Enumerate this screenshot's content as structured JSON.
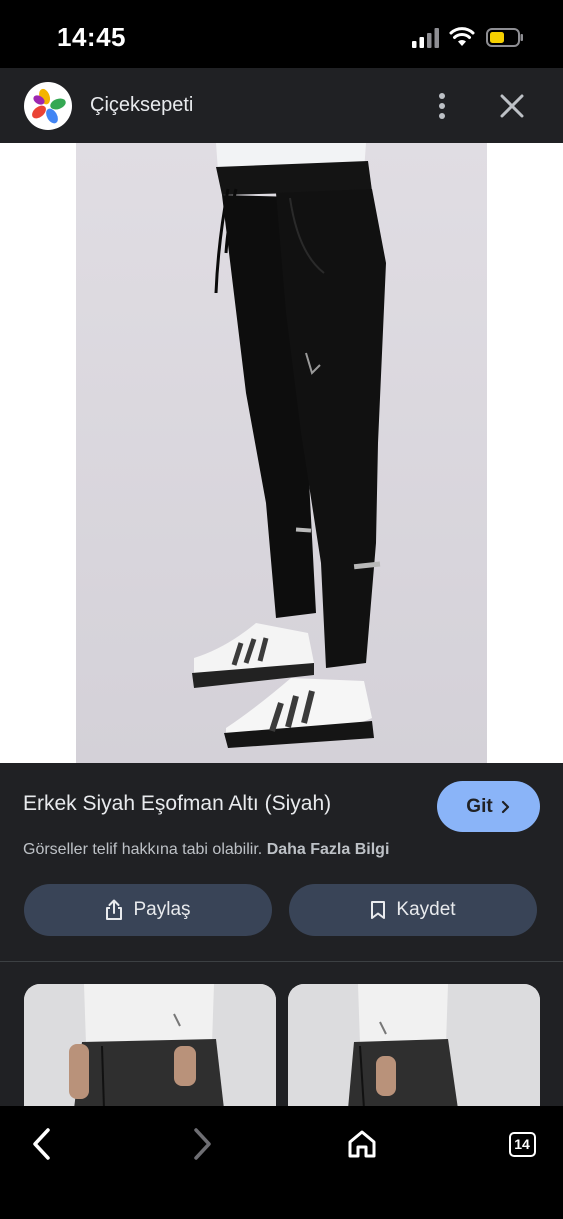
{
  "status_bar": {
    "time": "14:45"
  },
  "header": {
    "site_name": "Çiçeksepeti"
  },
  "result": {
    "title": "Erkek Siyah Eşofman Altı (Siyah)",
    "go_label": "Git",
    "copyright_text": "Görseller telif hakkına tabi olabilir.",
    "more_info_label": "Daha Fazla Bilgi",
    "share_label": "Paylaş",
    "save_label": "Kaydet"
  },
  "toolbar": {
    "tabs_count": "14"
  },
  "icons": {
    "signal": "cellular-signal-icon",
    "wifi": "wifi-icon",
    "battery": "battery-icon",
    "logo": "ciceksepeti-logo",
    "menu": "more-vert-icon",
    "close": "close-icon",
    "go": "chevron-right-icon",
    "share": "share-icon",
    "save": "bookmark-icon",
    "back": "back-arrow-icon",
    "forward": "forward-arrow-icon",
    "home": "home-icon",
    "tabs": "tabs-icon"
  },
  "colors": {
    "accent": "#8ab4f8",
    "button_bg": "#394457",
    "page_bg": "#202124",
    "battery_fill": "#f5d000"
  }
}
